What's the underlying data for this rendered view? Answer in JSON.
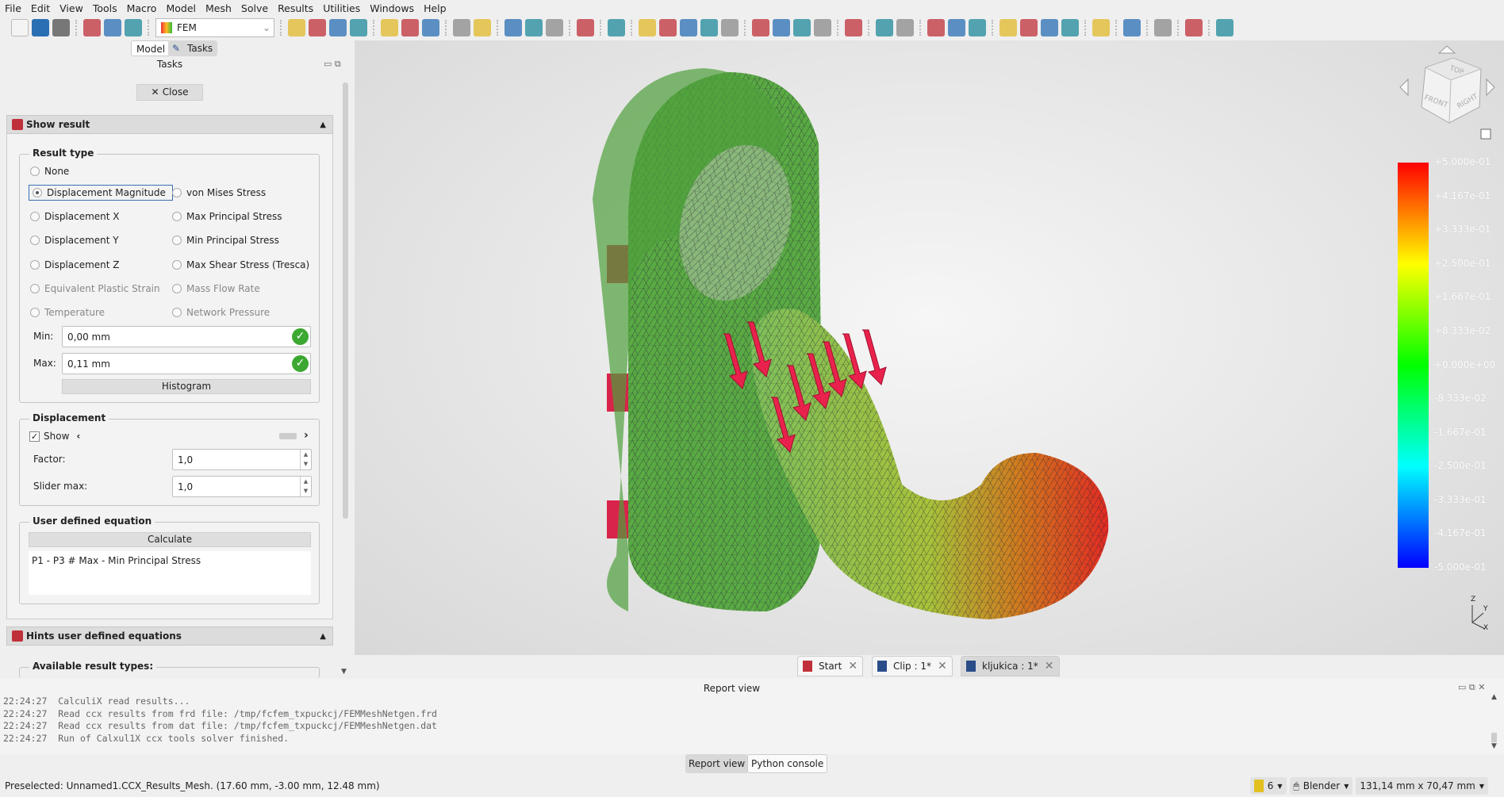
{
  "menu": [
    "File",
    "Edit",
    "View",
    "Tools",
    "Macro",
    "Model",
    "Mesh",
    "Solve",
    "Results",
    "Utilities",
    "Windows",
    "Help"
  ],
  "toolbar": {
    "workbench": "FEM",
    "icons": [
      "new-file-icon",
      "open-icon",
      "save-icon",
      "|",
      "undo-icon",
      "redo-icon",
      "refresh-icon",
      "|WB",
      "fit-all-icon",
      "fit-selection-icon",
      "std-views-icon",
      "draw-style-icon",
      "|",
      "sync-view-icon",
      "view-box-zoom-icon",
      "zoom-icon",
      "|",
      "measure-icon",
      "measure-angle-icon",
      "|",
      "part-icon",
      "group-icon",
      "link-icon",
      "|",
      "whats-this-icon",
      "|",
      "text-icon",
      "|",
      "sphere-icon",
      "cone-icon",
      "plane-icon",
      "partial-icon",
      "particles-icon",
      "|",
      "solid-icon",
      "beam-icon",
      "shell-icon",
      "fluid-icon",
      "|",
      "constraint-fixed-icon",
      "|",
      "wave-icon",
      "flow-icon",
      "|",
      "force-icon",
      "pressure-icon",
      "displacement-icon",
      "|",
      "heat-icon",
      "temp-icon",
      "flux-icon",
      "body-heat-icon",
      "|",
      "mesh-icon",
      "|",
      "solver-icon",
      "|",
      "results-icon",
      "|",
      "clip-icon",
      "|",
      "post-icon"
    ],
    "icon_colors": {
      "blue": "#2a6fb4",
      "teal": "#1d8a9a",
      "grey": "#8a8a8a",
      "yellow": "#e2b82a",
      "red": "#c0303a"
    }
  },
  "combo_tabs": {
    "model": "Model",
    "tasks": "Tasks"
  },
  "tasks": {
    "title": "Tasks",
    "close_label": "Close",
    "show_result": {
      "header": "Show result",
      "result_type": {
        "title": "Result type",
        "options": [
          {
            "label": "None",
            "checked": false,
            "enabled": true
          },
          {
            "label": "Displacement Magnitude",
            "checked": true,
            "enabled": true
          },
          {
            "label": "von Mises Stress",
            "checked": false,
            "enabled": true
          },
          {
            "label": "Displacement X",
            "checked": false,
            "enabled": true
          },
          {
            "label": "Max Principal Stress",
            "checked": false,
            "enabled": true
          },
          {
            "label": "Displacement Y",
            "checked": false,
            "enabled": true
          },
          {
            "label": "Min Principal Stress",
            "checked": false,
            "enabled": true
          },
          {
            "label": "Displacement Z",
            "checked": false,
            "enabled": true
          },
          {
            "label": "Max Shear Stress (Tresca)",
            "checked": false,
            "enabled": true
          },
          {
            "label": "Equivalent Plastic Strain",
            "checked": false,
            "enabled": false
          },
          {
            "label": "Mass Flow Rate",
            "checked": false,
            "enabled": false
          },
          {
            "label": "Temperature",
            "checked": false,
            "enabled": false
          },
          {
            "label": "Network Pressure",
            "checked": false,
            "enabled": false
          }
        ],
        "min_label": "Min:",
        "min_value": "0,00 mm",
        "max_label": "Max:",
        "max_value": "0,11 mm",
        "histogram_label": "Histogram"
      },
      "displacement": {
        "title": "Displacement",
        "show_label": "Show",
        "show_checked": true,
        "factor_label": "Factor:",
        "factor_value": "1,0",
        "slider_max_label": "Slider max:",
        "slider_max_value": "1,0",
        "slider_value": 0
      },
      "user_equation": {
        "title": "User defined equation",
        "calculate_label": "Calculate",
        "equation": "P1 - P3 # Max - Min Principal Stress"
      }
    },
    "hints": {
      "header": "Hints user defined equations",
      "available_label": "Available result types:"
    }
  },
  "viewport": {
    "navcube": {
      "top": "TOP",
      "front": "FRONT",
      "right": "RIGHT"
    },
    "colorbar": {
      "labels": [
        "+5.000e-01",
        "+4.167e-01",
        "+3.333e-01",
        "+2.500e-01",
        "+1.667e-01",
        "+8.333e-02",
        "+0.000e+00",
        "-8.333e-02",
        "-1.667e-01",
        "-2.500e-01",
        "-3.333e-01",
        "-4.167e-01",
        "-5.000e-01"
      ],
      "colors": [
        "#ff0000",
        "#ffff00",
        "#00ff00",
        "#00ffff",
        "#0000ff"
      ]
    },
    "axis": {
      "x": "X",
      "y": "Y",
      "z": "Z"
    }
  },
  "doc_tabs": [
    {
      "label": "Start",
      "active": false
    },
    {
      "label": "Clip : 1*",
      "active": false
    },
    {
      "label": "kljukica : 1*",
      "active": true
    }
  ],
  "report": {
    "title": "Report view",
    "lines": [
      {
        "time": "22:24:27",
        "text": "CalculiX read results..."
      },
      {
        "time": "22:24:27",
        "text": "Read ccx results from frd file: /tmp/fcfem_txpuckcj/FEMMeshNetgen.frd"
      },
      {
        "time": "22:24:27",
        "text": "Read ccx results from dat file: /tmp/fcfem_txpuckcj/FEMMeshNetgen.dat"
      },
      {
        "time": "22:24:27",
        "text": "Run of Calxul1X ccx tools solver finished."
      }
    ],
    "tabs": [
      "Report view",
      "Python console"
    ]
  },
  "status": {
    "message": "Preselected: Unnamed1.CCX_Results_Mesh. (17.60 mm, -3.00 mm, 12.48 mm)",
    "layer_count": "6",
    "nav_style": "Blender",
    "dimensions": "131,14 mm x 70,47 mm"
  }
}
